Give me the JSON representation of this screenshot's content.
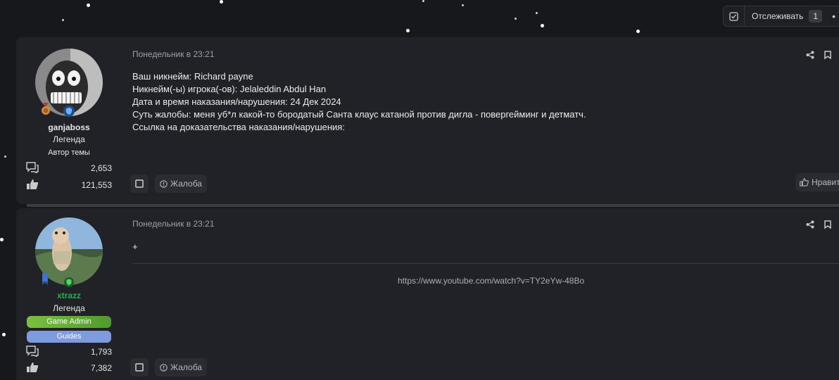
{
  "topbar": {
    "watch_label": "Отслеживать",
    "watch_count": "1"
  },
  "posts": [
    {
      "username": "ganjaboss",
      "user_title": "Легенда",
      "user_extra": "Автор темы",
      "messages_count": "2,653",
      "reactions_count": "121,553",
      "date": "Понедельник в 23:21",
      "body_lines": [
        "Ваш никнейм: Richard payne",
        "Никнейм(-ы) игрока(-ов): Jelaleddin Abdul Han",
        "Дата и время наказания/нарушения: 24 Дек 2024",
        "Суть жалобы: меня уб*л какой-то бородатый Санта клаус катаной против дигла - повергейминг и детматч.",
        "Ссылка на доказательства наказания/нарушения:"
      ],
      "report_label": "Жалоба",
      "like_label": "Нравит"
    },
    {
      "username": "xtrazz",
      "user_title": "Легенда",
      "roles": [
        "Game Admin",
        "Guides"
      ],
      "messages_count": "1,793",
      "reactions_count": "7,382",
      "date": "Понедельник в 23:21",
      "body_lines": [
        "+"
      ],
      "link": "https://www.youtube.com/watch?v=TY2eYw-48Bo",
      "report_label": "Жалоба"
    }
  ],
  "colors": {
    "background": "#17181c",
    "post_bg": "#212227",
    "username_green": "#22b14c",
    "game_admin_role": "#6cb33f",
    "guides_role": "#7e9be0"
  }
}
